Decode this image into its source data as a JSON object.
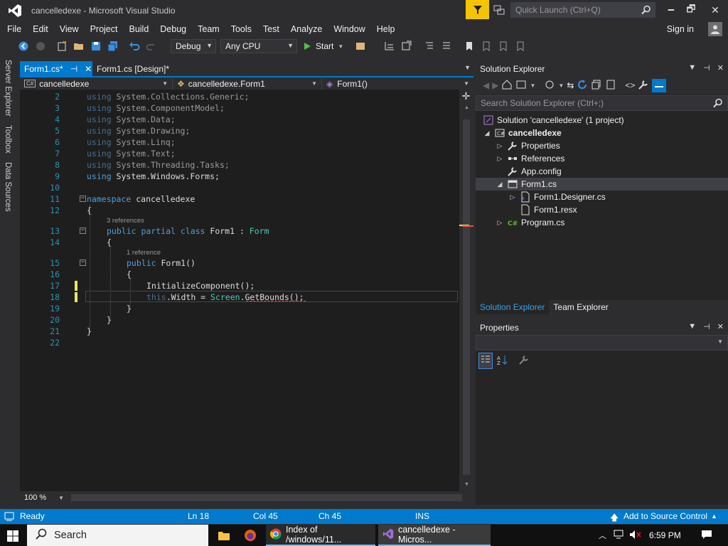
{
  "window": {
    "title": "cancelledexe - Microsoft Visual Studio",
    "quick_launch_placeholder": "Quick Launch (Ctrl+Q)",
    "minimize": "🗕",
    "maximize": "🗗",
    "close": "✕"
  },
  "menu": [
    "File",
    "Edit",
    "View",
    "Project",
    "Build",
    "Debug",
    "Team",
    "Tools",
    "Test",
    "Analyze",
    "Window",
    "Help"
  ],
  "account": {
    "signin": "Sign in"
  },
  "toolbar": {
    "config": "Debug",
    "platform": "Any CPU",
    "start": "Start"
  },
  "left_tabs": [
    "Server Explorer",
    "Toolbox",
    "Data Sources"
  ],
  "doc_tabs": [
    {
      "label": "Form1.cs*",
      "active": true
    },
    {
      "label": "Form1.cs [Design]*",
      "active": false
    }
  ],
  "navbar": {
    "project": "cancelledexe",
    "class": "cancelledexe.Form1",
    "member": "Form1()",
    "cs_badge": "C#"
  },
  "editor": {
    "codelens_class": "3 references",
    "codelens_ctor": "1 reference",
    "zoom": "100 %",
    "lines": [
      {
        "n": "2",
        "kw": "using",
        "rest": " System.Collections.Generic;"
      },
      {
        "n": "3",
        "kw": "using",
        "rest": " System.ComponentModel;"
      },
      {
        "n": "4",
        "kw": "using",
        "rest": " System.Data;"
      },
      {
        "n": "5",
        "kw": "using",
        "rest": " System.Drawing;"
      },
      {
        "n": "6",
        "kw": "using",
        "rest": " System.Linq;"
      },
      {
        "n": "7",
        "kw": "using",
        "rest": " System.Text;"
      },
      {
        "n": "8",
        "kw": "using",
        "rest": " System.Threading.Tasks;"
      },
      {
        "n": "9",
        "kw": "using",
        "rest": " System.Windows.Forms;"
      },
      {
        "n": "10"
      },
      {
        "n": "11",
        "kw": "namespace",
        "rest": " cancelledexe"
      },
      {
        "n": "12",
        "rest": "{"
      },
      {
        "n": "13",
        "kw": "public partial class",
        "rest": " Form1 : ",
        "type": "Form"
      },
      {
        "n": "14",
        "rest": "{"
      },
      {
        "n": "15",
        "kw": "public",
        "rest": " Form1()"
      },
      {
        "n": "16",
        "rest": "{"
      },
      {
        "n": "17",
        "rest": "InitializeComponent();"
      },
      {
        "n": "18",
        "kw": "this",
        "rest": ".Width = ",
        "type": "Screen",
        "rest2": ".GetBounds();"
      },
      {
        "n": "19",
        "rest": "}"
      },
      {
        "n": "20",
        "rest": "}"
      },
      {
        "n": "21",
        "rest": "}"
      },
      {
        "n": "22"
      }
    ]
  },
  "solution_explorer": {
    "title": "Solution Explorer",
    "search_placeholder": "Search Solution Explorer (Ctrl+;)",
    "items": [
      {
        "label": "Solution 'cancelledexe' (1 project)",
        "depth": 0,
        "expander": "",
        "icon": "solution-icon"
      },
      {
        "label": "cancelledexe",
        "depth": 1,
        "expander": "◢",
        "icon": "csharp-project-icon",
        "bold": true
      },
      {
        "label": "Properties",
        "depth": 2,
        "expander": "▷",
        "icon": "wrench-icon"
      },
      {
        "label": "References",
        "depth": 2,
        "expander": "▷",
        "icon": "references-icon"
      },
      {
        "label": "App.config",
        "depth": 2,
        "expander": "",
        "icon": "config-file-icon"
      },
      {
        "label": "Form1.cs",
        "depth": 2,
        "expander": "◢",
        "icon": "form-icon",
        "selected": true
      },
      {
        "label": "Form1.Designer.cs",
        "depth": 3,
        "expander": "▷",
        "icon": "code-file-icon"
      },
      {
        "label": "Form1.resx",
        "depth": 3,
        "expander": "",
        "icon": "resx-file-icon"
      },
      {
        "label": "Program.cs",
        "depth": 2,
        "expander": "▷",
        "icon": "csharp-file-icon"
      }
    ],
    "tabs": [
      "Solution Explorer",
      "Team Explorer"
    ]
  },
  "properties": {
    "title": "Properties"
  },
  "status": {
    "ready": "Ready",
    "ln": "Ln 18",
    "col": "Col 45",
    "ch": "Ch 45",
    "ins": "INS",
    "source_control": "Add to Source Control"
  },
  "taskbar": {
    "search": "Search",
    "apps": [
      {
        "label": "Index of /windows/11...",
        "icon": "chrome-icon"
      },
      {
        "label": "cancelledexe - Micros...",
        "icon": "visual-studio-icon"
      }
    ],
    "time": "6:59 PM"
  },
  "colors": {
    "accent": "#007acc",
    "notification": "#f5c400",
    "keyword": "#569cd6",
    "type": "#4ec9b0",
    "line_number": "#2b91af"
  }
}
